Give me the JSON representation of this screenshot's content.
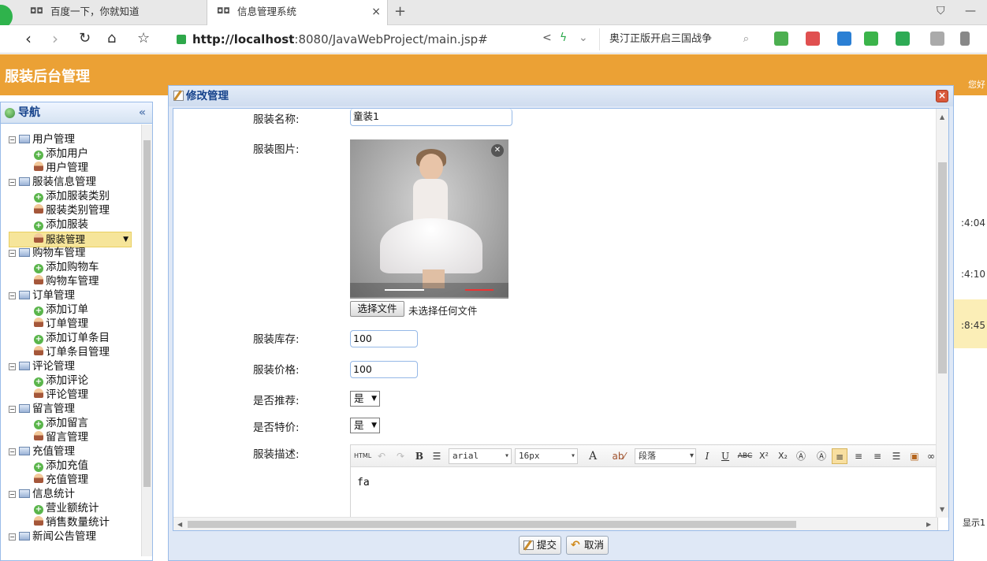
{
  "browser": {
    "tabs": [
      {
        "label": "百度一下，你就知道"
      },
      {
        "label": "信息管理系统",
        "close": "×"
      }
    ],
    "newtab": "+",
    "url_host": "http://localhost",
    "url_rest": ":8080/JavaWebProject/main.jsp#",
    "search_text": "奥汀正版开启三国战争",
    "icons": [
      "back-icon",
      "forward-icon",
      "refresh-icon",
      "home-icon",
      "star-icon",
      "share-icon",
      "lightning-icon",
      "search-icon",
      "extension-icon"
    ]
  },
  "app": {
    "title": "服装后台管理",
    "hello": "您好"
  },
  "sidebar": {
    "title": "导航",
    "collapse": "«",
    "items": [
      {
        "label": "用户管理"
      },
      {
        "label": "添加用户"
      },
      {
        "label": "用户管理"
      },
      {
        "label": "服装信息管理"
      },
      {
        "label": "添加服装类别"
      },
      {
        "label": "服装类别管理"
      },
      {
        "label": "添加服装"
      },
      {
        "label": "服装管理"
      },
      {
        "label": "购物车管理"
      },
      {
        "label": "添加购物车"
      },
      {
        "label": "购物车管理"
      },
      {
        "label": "订单管理"
      },
      {
        "label": "添加订单"
      },
      {
        "label": "订单管理"
      },
      {
        "label": "添加订单条目"
      },
      {
        "label": "订单条目管理"
      },
      {
        "label": "评论管理"
      },
      {
        "label": "添加评论"
      },
      {
        "label": "评论管理"
      },
      {
        "label": "留言管理"
      },
      {
        "label": "添加留言"
      },
      {
        "label": "留言管理"
      },
      {
        "label": "充值管理"
      },
      {
        "label": "添加充值"
      },
      {
        "label": "充值管理"
      },
      {
        "label": "信息统计"
      },
      {
        "label": "营业额统计"
      },
      {
        "label": "销售数量统计"
      },
      {
        "label": "新闻公告管理"
      }
    ]
  },
  "background_grid": {
    "times": [
      ":4:04",
      ":4:10",
      ":8:45"
    ],
    "footer": "显示1"
  },
  "modal": {
    "title": "修改管理",
    "close": "×",
    "fields": {
      "name_label": "服装名称:",
      "name_value": "童装1",
      "image_label": "服装图片:",
      "file_button": "选择文件",
      "file_status": "未选择任何文件",
      "stock_label": "服装库存:",
      "stock_value": "100",
      "price_label": "服装价格:",
      "price_value": "100",
      "recommend_label": "是否推荐:",
      "recommend_value": "是",
      "special_label": "是否特价:",
      "special_value": "是",
      "desc_label": "服装描述:"
    },
    "editor": {
      "html": "HTML",
      "bold": "B",
      "font": "arial",
      "size": "16px",
      "color": "A",
      "para": "段落",
      "italic": "I",
      "underline": "U",
      "strike": "ABC",
      "sup": "X²",
      "sub": "X₂",
      "content": "fa"
    },
    "buttons": {
      "submit": "提交",
      "cancel": "取消"
    }
  }
}
